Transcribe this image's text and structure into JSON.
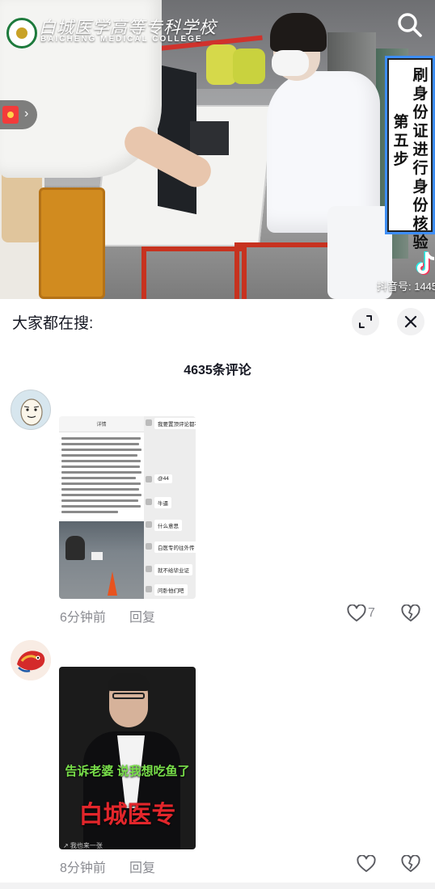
{
  "video": {
    "school_name_cn": "白城医学高等专科学校",
    "school_name_en": "BAICHENG MEDICAL COLLEGE",
    "step_caption_col1": "刷身份证进行身份核验",
    "step_caption_col2": "第五步",
    "watermark": "抖音号: 1445"
  },
  "panel": {
    "search_title": "大家都在搜:",
    "comment_count": "4635条评论"
  },
  "comments": [
    {
      "time": "6分钟前",
      "reply": "回复",
      "likes": "7",
      "screenshot": {
        "header": "详情",
        "messages": [
          "我要置顶评论都不",
          "@44",
          "牛逼",
          "什么意思",
          "白医专的往外传",
          "就不给毕业证",
          "问卧他们吧"
        ]
      }
    },
    {
      "time": "8分钟前",
      "reply": "回复",
      "likes": "",
      "image": {
        "caption_green": "告诉老婆 说我想吃鱼了",
        "caption_red": "白城医专",
        "corner_text": "↗ 我也来一张"
      }
    }
  ],
  "icons": {
    "search": "search-icon",
    "expand": "expand-icon",
    "close": "close-icon",
    "like": "heart-icon",
    "dislike": "broken-heart-icon"
  },
  "colors": {
    "accent_blue": "#3d8df5",
    "caption_red": "#e2262b",
    "caption_green": "#79e04a",
    "muted_text": "#8a8b91"
  }
}
